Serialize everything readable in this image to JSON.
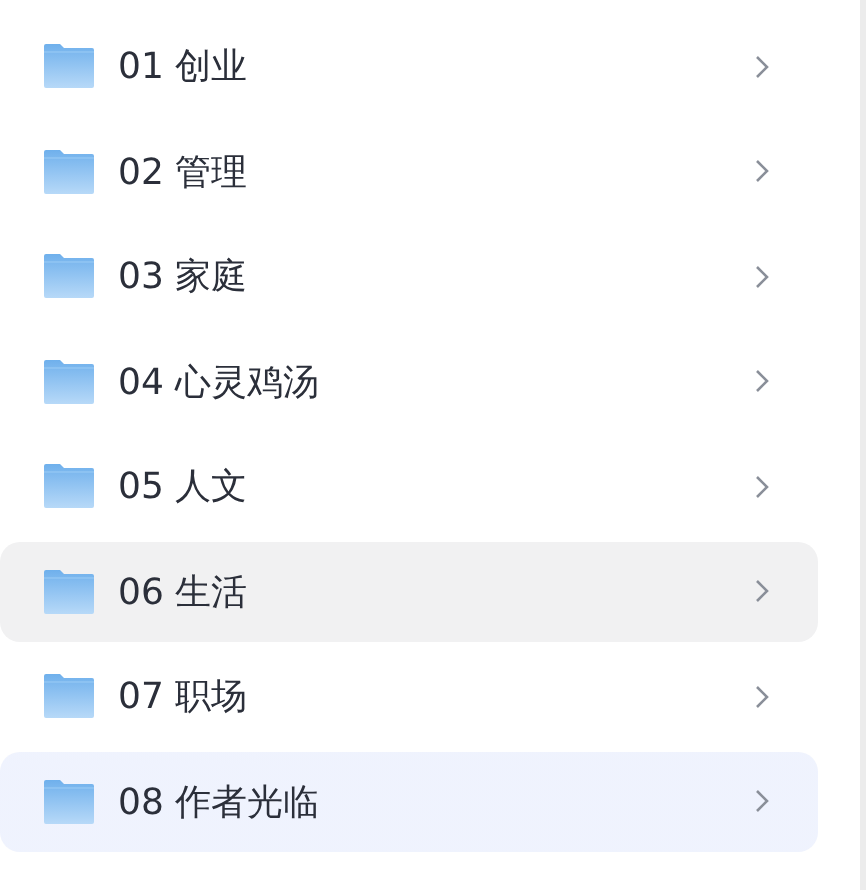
{
  "folders": [
    {
      "label": "01 创业",
      "hovered": false,
      "selected": false
    },
    {
      "label": "02 管理",
      "hovered": false,
      "selected": false
    },
    {
      "label": "03 家庭",
      "hovered": false,
      "selected": false
    },
    {
      "label": "04 心灵鸡汤",
      "hovered": false,
      "selected": false
    },
    {
      "label": "05 人文",
      "hovered": false,
      "selected": false
    },
    {
      "label": "06 生活",
      "hovered": true,
      "selected": false
    },
    {
      "label": "07 职场",
      "hovered": false,
      "selected": false
    },
    {
      "label": "08 作者光临",
      "hovered": false,
      "selected": true
    }
  ]
}
